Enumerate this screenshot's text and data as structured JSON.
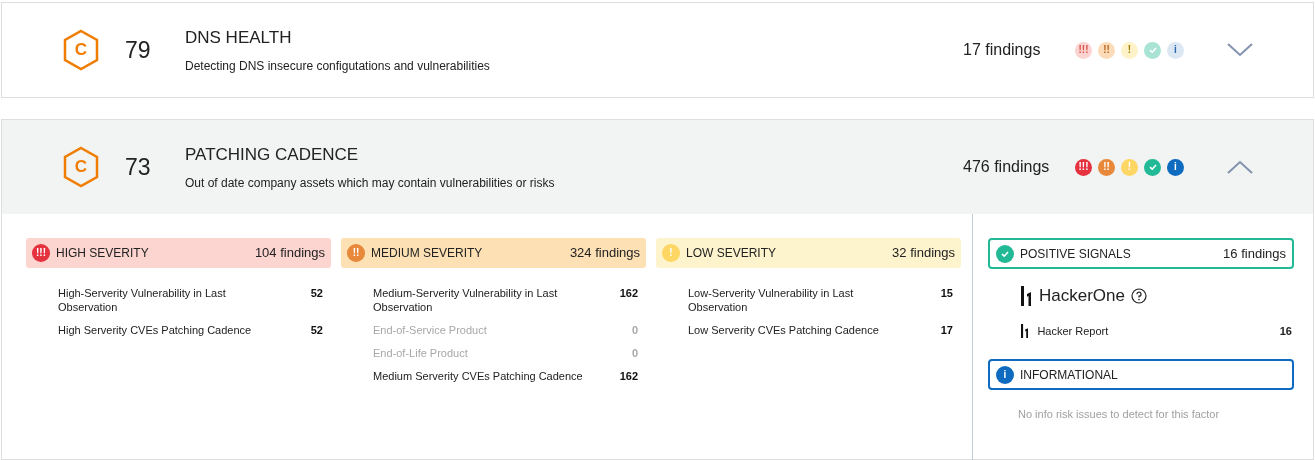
{
  "factors": [
    {
      "grade": "C",
      "score": "79",
      "title": "DNS HEALTH",
      "description": "Detecting DNS insecure configutations and vulnerabilities",
      "findings": "17 findings",
      "expanded": false,
      "indicators": [
        {
          "kind": "high",
          "glyph": "!!!"
        },
        {
          "kind": "medium",
          "glyph": "!!"
        },
        {
          "kind": "low",
          "glyph": "!"
        },
        {
          "kind": "positive"
        },
        {
          "kind": "info",
          "glyph": "i"
        }
      ]
    },
    {
      "grade": "C",
      "score": "73",
      "title": "PATCHING CADENCE",
      "description": "Out of date company assets which may contain vulnerabilities or risks",
      "findings": "476 findings",
      "expanded": true,
      "indicators": [
        {
          "kind": "high",
          "glyph": "!!!"
        },
        {
          "kind": "medium",
          "glyph": "!!"
        },
        {
          "kind": "low",
          "glyph": "!"
        },
        {
          "kind": "positive"
        },
        {
          "kind": "info",
          "glyph": "i"
        }
      ],
      "severities": [
        {
          "kind": "high",
          "glyph": "!!!",
          "label": "HIGH SEVERITY",
          "findings": "104 findings",
          "items": [
            {
              "name": "High-Serverity Vulnerability in Last Observation",
              "count": "52",
              "disabled": false
            },
            {
              "name": "High Serverity CVEs Patching Cadence",
              "count": "52",
              "disabled": false
            }
          ]
        },
        {
          "kind": "medium",
          "glyph": "!!",
          "label": "MEDIUM SEVERITY",
          "findings": "324 findings",
          "items": [
            {
              "name": "Medium-Serverity Vulnerability in Last Observation",
              "count": "162",
              "disabled": false
            },
            {
              "name": "End-of-Service Product",
              "count": "0",
              "disabled": true
            },
            {
              "name": "End-of-Life Product",
              "count": "0",
              "disabled": true
            },
            {
              "name": "Medium Serverity CVEs Patching Cadence",
              "count": "162",
              "disabled": false
            }
          ]
        },
        {
          "kind": "low",
          "glyph": "!",
          "label": "LOW SEVERITY",
          "findings": "32 findings",
          "items": [
            {
              "name": "Low-Serverity Vulnerability in Last Observation",
              "count": "15",
              "disabled": false
            },
            {
              "name": "Low Serverity CVEs Patching Cadence",
              "count": "17",
              "disabled": false
            }
          ]
        }
      ],
      "positive": {
        "label": "POSITIVE SIGNALS",
        "findings": "16 findings",
        "provider": "HackerOne",
        "items": [
          {
            "name": "Hacker Report",
            "count": "16"
          }
        ]
      },
      "informational": {
        "glyph": "i",
        "label": "INFORMATIONAL",
        "empty_text": "No info risk issues to detect for this factor"
      }
    }
  ]
}
